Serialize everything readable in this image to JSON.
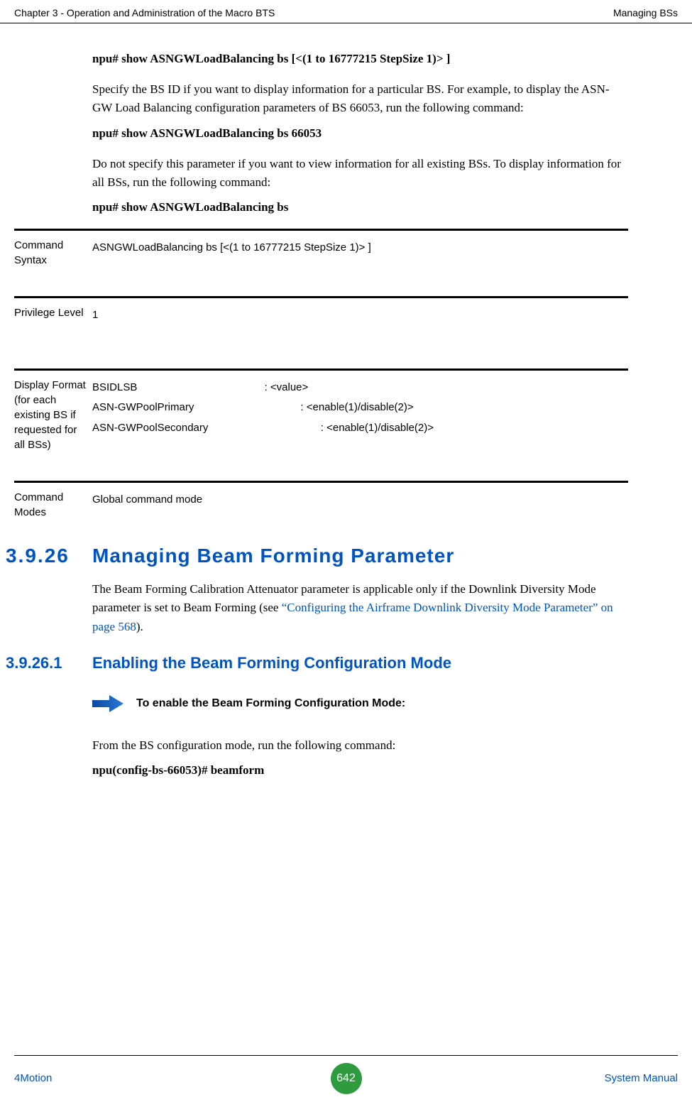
{
  "header": {
    "left": "Chapter 3 - Operation and Administration of the Macro BTS",
    "right": "Managing BSs"
  },
  "body": {
    "cmd1": "npu# show ASNGWLoadBalancing bs [<(1 to 16777215 StepSize 1)> ]",
    "p1": "Specify the BS ID if you want to display information for a particular BS. For example, to display the ASN-GW Load Balancing configuration parameters of BS 66053, run the following command:",
    "cmd2": "npu# show ASNGWLoadBalancing bs 66053",
    "p2": "Do not specify this parameter if you want to view information for all existing BSs. To display information for all BSs, run the following command:",
    "cmd3": "npu# show ASNGWLoadBalancing bs"
  },
  "info": {
    "syntax_label": "Command Syntax",
    "syntax_value": "ASNGWLoadBalancing bs [<(1 to 16777215 StepSize 1)> ]",
    "priv_label": "Privilege Level",
    "priv_value": "1",
    "display_label": "Display Format\n(for each existing BS if requested for all BSs)",
    "display_line1": "BSIDLSB                                           : <value>",
    "display_line2": "ASN-GWPoolPrimary                                    : <enable(1)/disable(2)>",
    "display_line3": "ASN-GWPoolSecondary                                      : <enable(1)/disable(2)>",
    "modes_label": "Command Modes",
    "modes_value": "Global command mode"
  },
  "section": {
    "num": "3.9.26",
    "title": "Managing Beam Forming Parameter",
    "p_before": "The Beam Forming Calibration Attenuator parameter is applicable only if the Downlink Diversity Mode parameter is set to Beam Forming (see ",
    "p_link": "“Configuring the Airframe Downlink Diversity Mode Parameter” on page 568",
    "p_after": ")."
  },
  "subsection": {
    "num": "3.9.26.1",
    "title": "Enabling the Beam Forming Configuration Mode"
  },
  "callout": {
    "text": "To enable the Beam Forming Configuration Mode:"
  },
  "tail": {
    "p": "From the BS configuration mode, run the following command:",
    "cmd": "npu(config-bs-66053)# beamform"
  },
  "footer": {
    "left": "4Motion",
    "page": "642",
    "right": "System Manual"
  }
}
